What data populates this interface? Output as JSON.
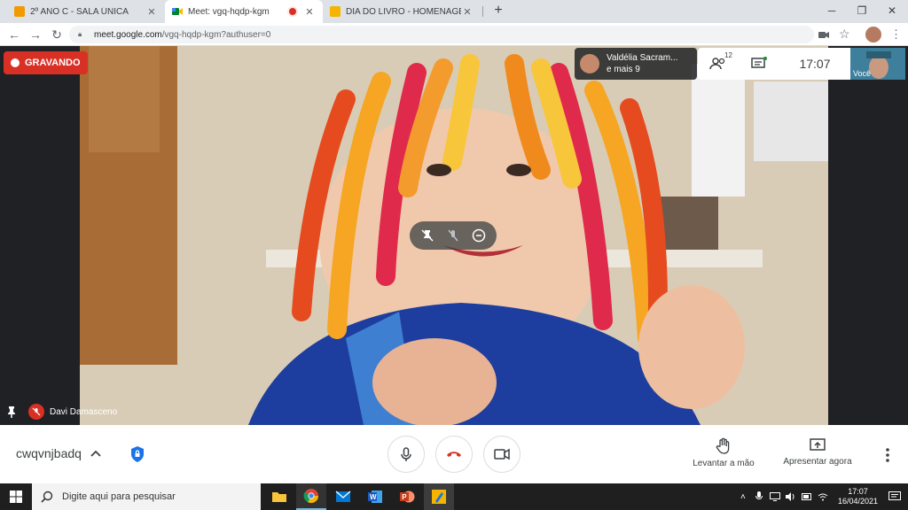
{
  "browser": {
    "tabs": [
      {
        "title": "2º ANO C - SALA ÚNICA",
        "icon": "classroom-icon",
        "color": "#f29900"
      },
      {
        "title": "Meet: vgq-hqdp-kgm",
        "icon": "meet-icon",
        "color": "#00832d",
        "recording": true
      },
      {
        "title": "DIA DO LIVRO - HOMENAGEM A",
        "icon": "slides-icon",
        "color": "#f4b400"
      }
    ],
    "url_host": "meet.google.com",
    "url_path": "/vgq-hqdp-kgm?authuser=0"
  },
  "meet": {
    "recording_label": "GRAVANDO",
    "participants_chip": {
      "line1": "Valdélia Sacram...",
      "line2": "e mais 9"
    },
    "participant_count": "12",
    "time": "17:07",
    "self_label": "Você",
    "speaker_name": "Davi Damasceno",
    "meeting_code": "cwqvnjbadq",
    "raise_hand_label": "Levantar a mão",
    "present_label": "Apresentar agora",
    "colors": {
      "end_call": "#d93025",
      "recording": "#d93025",
      "accent": "#1a73e8"
    }
  },
  "taskbar": {
    "search_placeholder": "Digite aqui para pesquisar",
    "clock_time": "17:07",
    "clock_date": "16/04/2021"
  }
}
